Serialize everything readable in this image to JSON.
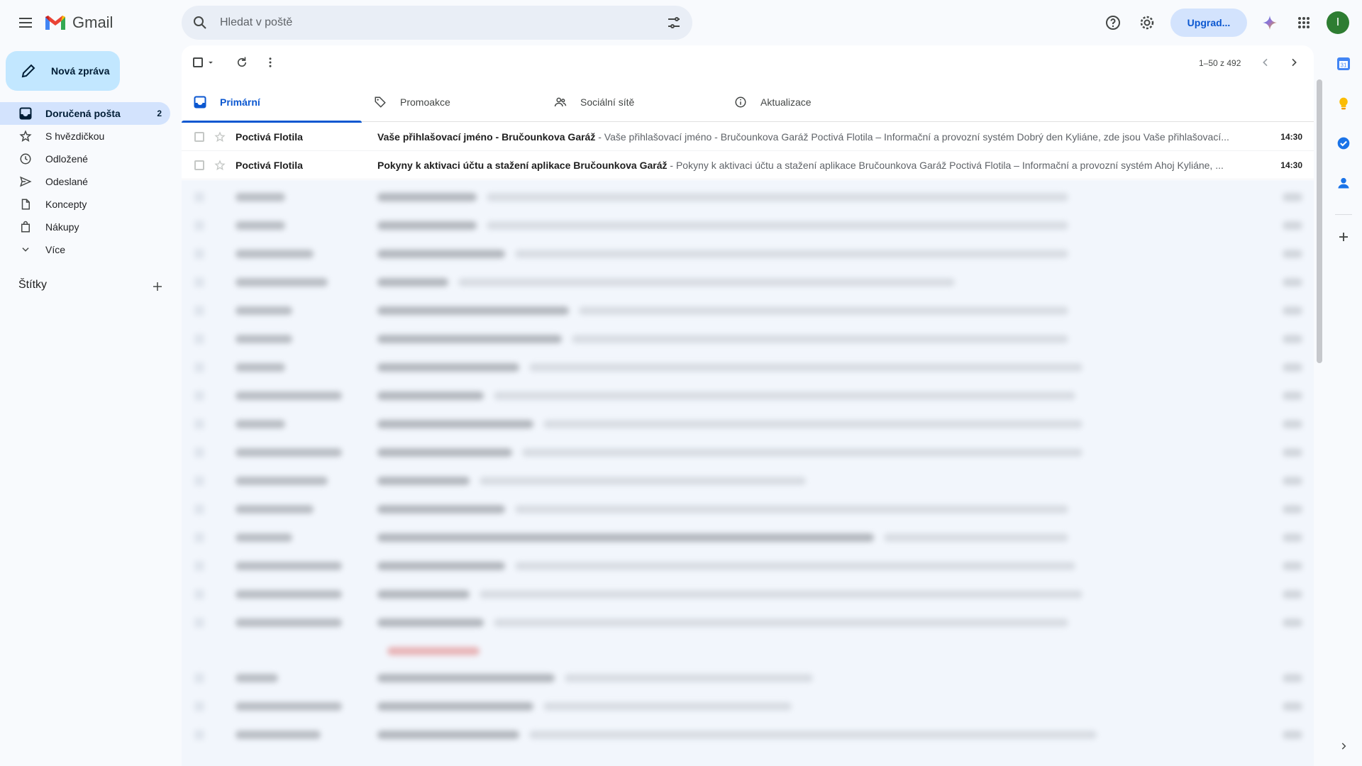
{
  "app": {
    "name": "Gmail"
  },
  "search": {
    "placeholder": "Hledat v poště"
  },
  "header": {
    "upgrade_label": "Upgrad...",
    "avatar_initial": "I"
  },
  "sidebar": {
    "compose_label": "Nová zpráva",
    "items": [
      {
        "label": "Doručená pošta",
        "count": "2",
        "icon": "inbox-icon",
        "active": true
      },
      {
        "label": "S hvězdičkou",
        "count": "",
        "icon": "star-icon",
        "active": false
      },
      {
        "label": "Odložené",
        "count": "",
        "icon": "clock-icon",
        "active": false
      },
      {
        "label": "Odeslané",
        "count": "",
        "icon": "send-icon",
        "active": false
      },
      {
        "label": "Koncepty",
        "count": "",
        "icon": "draft-icon",
        "active": false
      },
      {
        "label": "Nákupy",
        "count": "",
        "icon": "shopping-icon",
        "active": false
      },
      {
        "label": "Více",
        "count": "",
        "icon": "chevron-down-icon",
        "active": false
      }
    ],
    "labels_heading": "Štítky"
  },
  "toolbar": {
    "pagination": "1–50 z 492"
  },
  "tabs": [
    {
      "label": "Primární",
      "icon": "inbox-icon",
      "active": true
    },
    {
      "label": "Promoakce",
      "icon": "tag-icon",
      "active": false
    },
    {
      "label": "Sociální sítě",
      "icon": "people-icon",
      "active": false
    },
    {
      "label": "Aktualizace",
      "icon": "info-icon",
      "active": false
    }
  ],
  "emails": [
    {
      "sender": "Poctivá Flotila",
      "subject": "Vaše přihlašovací jméno - Bručounkova Garáž",
      "snippet": " - Vaše přihlašovací jméno - Bručounkova Garáž Poctivá Flotila – Informační a provozní systém Dobrý den Kyliáne, zde jsou Vaše přihlašovací...",
      "time": "14:30"
    },
    {
      "sender": "Poctivá Flotila",
      "subject": "Pokyny k aktivaci účtu a stažení aplikace Bručounkova Garáž",
      "snippet": " - Pokyny k aktivaci účtu a stažení aplikace Bručounkova Garáž Poctivá Flotila – Informační a provozní systém Ahoj Kyliáne, ...",
      "time": "14:30"
    }
  ],
  "colors": {
    "accent": "#0b57d0",
    "compose_bg": "#c2e7ff",
    "active_nav_bg": "#d3e3fd",
    "avatar_bg": "#2e7d32"
  }
}
